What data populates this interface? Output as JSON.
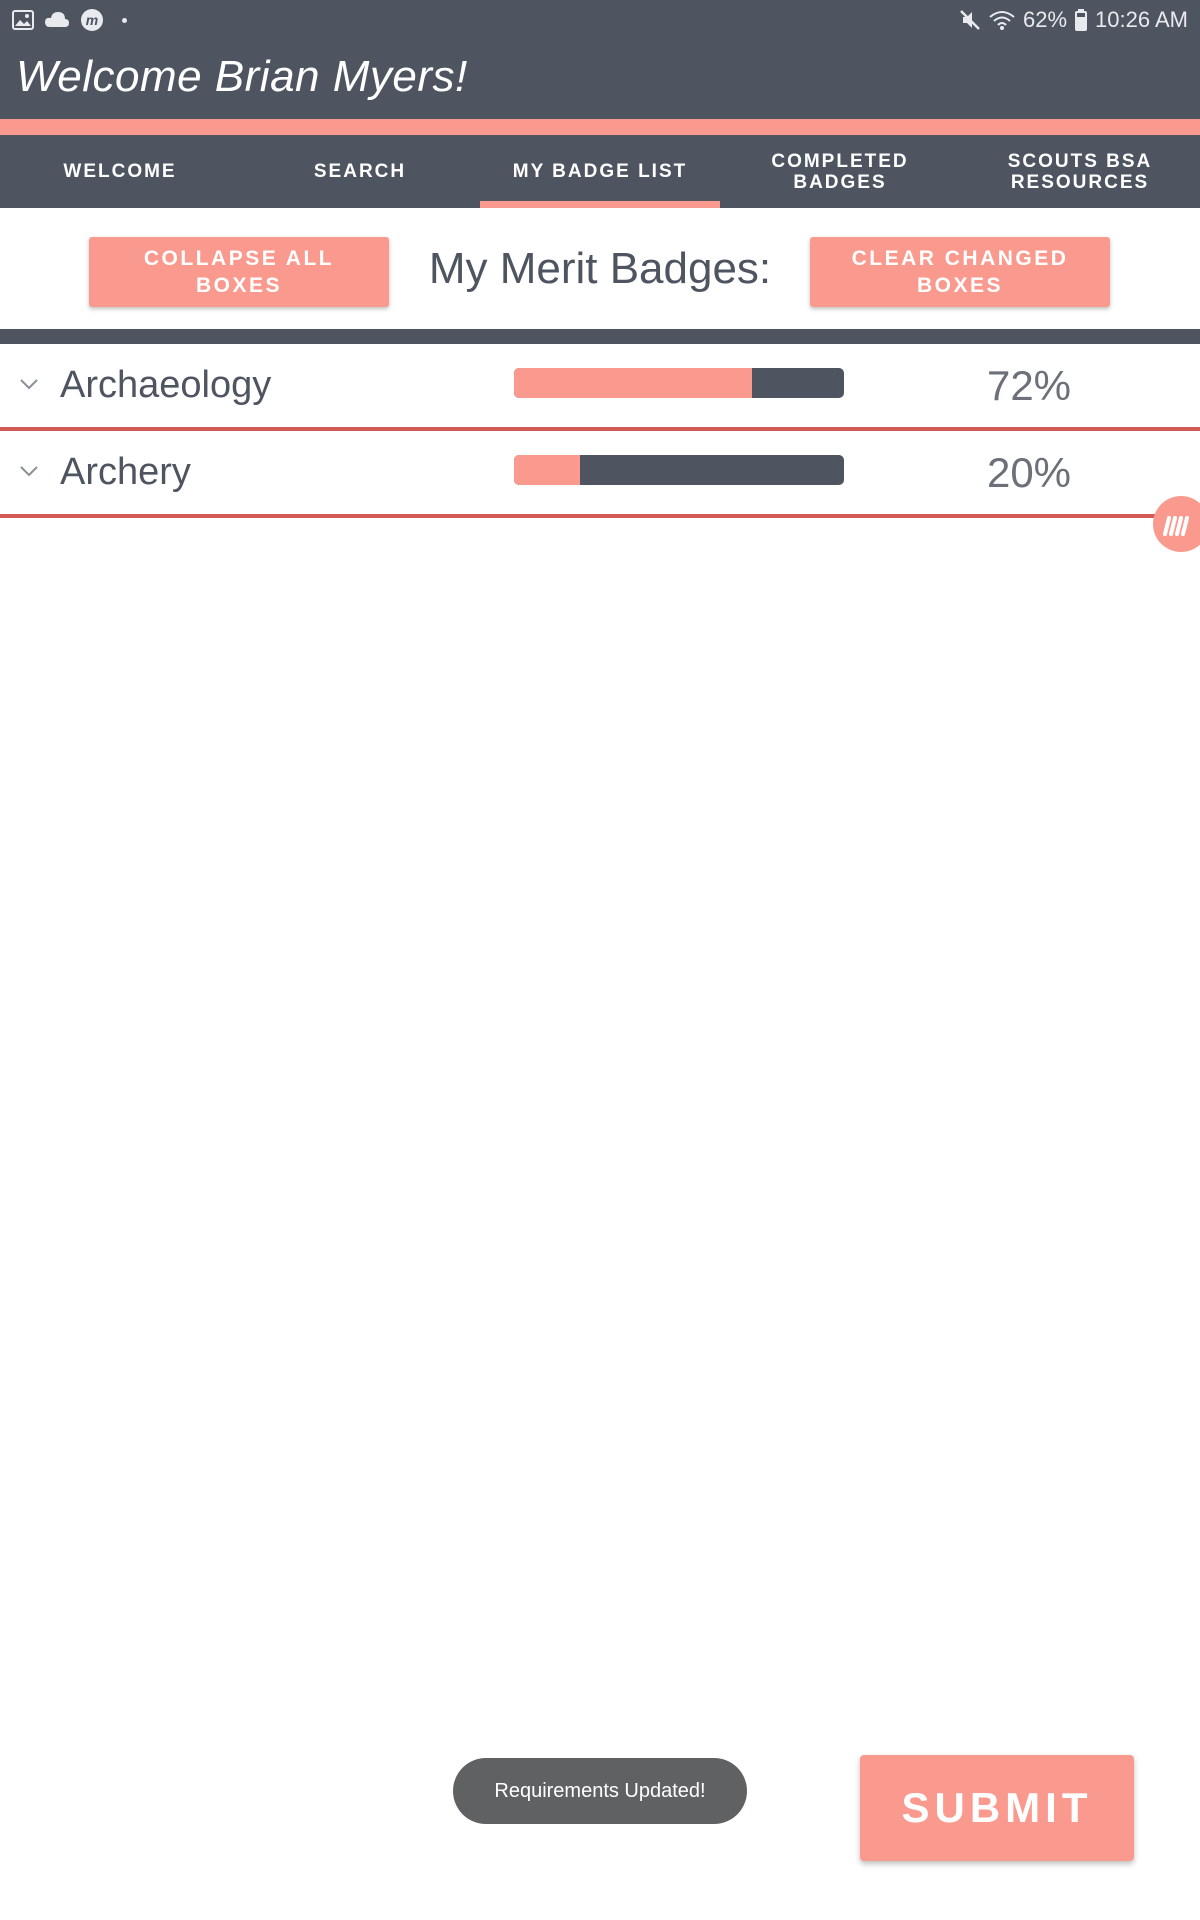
{
  "status_bar": {
    "left_icons": [
      "gallery-icon",
      "cloud-icon",
      "merit-app-icon",
      "notification-dot"
    ],
    "right_icons": [
      "mute-icon",
      "wifi-icon",
      "battery-icon"
    ],
    "battery": "62%",
    "time": "10:26 AM"
  },
  "header": {
    "title": "Welcome Brian Myers!"
  },
  "tabs": [
    {
      "label": "WELCOME",
      "active": false
    },
    {
      "label": "SEARCH",
      "active": false
    },
    {
      "label": "MY BADGE LIST",
      "active": true
    },
    {
      "label": "COMPLETED\nBADGES",
      "active": false
    },
    {
      "label": "SCOUTS BSA\nRESOURCES",
      "active": false
    }
  ],
  "actions": {
    "collapse_label": "COLLAPSE ALL BOXES",
    "section_title": "My Merit Badges:",
    "clear_label": "CLEAR CHANGED BOXES"
  },
  "badges": [
    {
      "name": "Archaeology",
      "progress": 0.72,
      "percent_label": "72%"
    },
    {
      "name": "Archery",
      "progress": 0.2,
      "percent_label": "20%"
    }
  ],
  "toast": {
    "message": "Requirements Updated!"
  },
  "submit": {
    "label": "SUBMIT"
  },
  "colors": {
    "header_bg": "#4e5561",
    "accent": "#fa9a8f",
    "row_border": "#d35a55",
    "text_dark": "#4e5561"
  }
}
